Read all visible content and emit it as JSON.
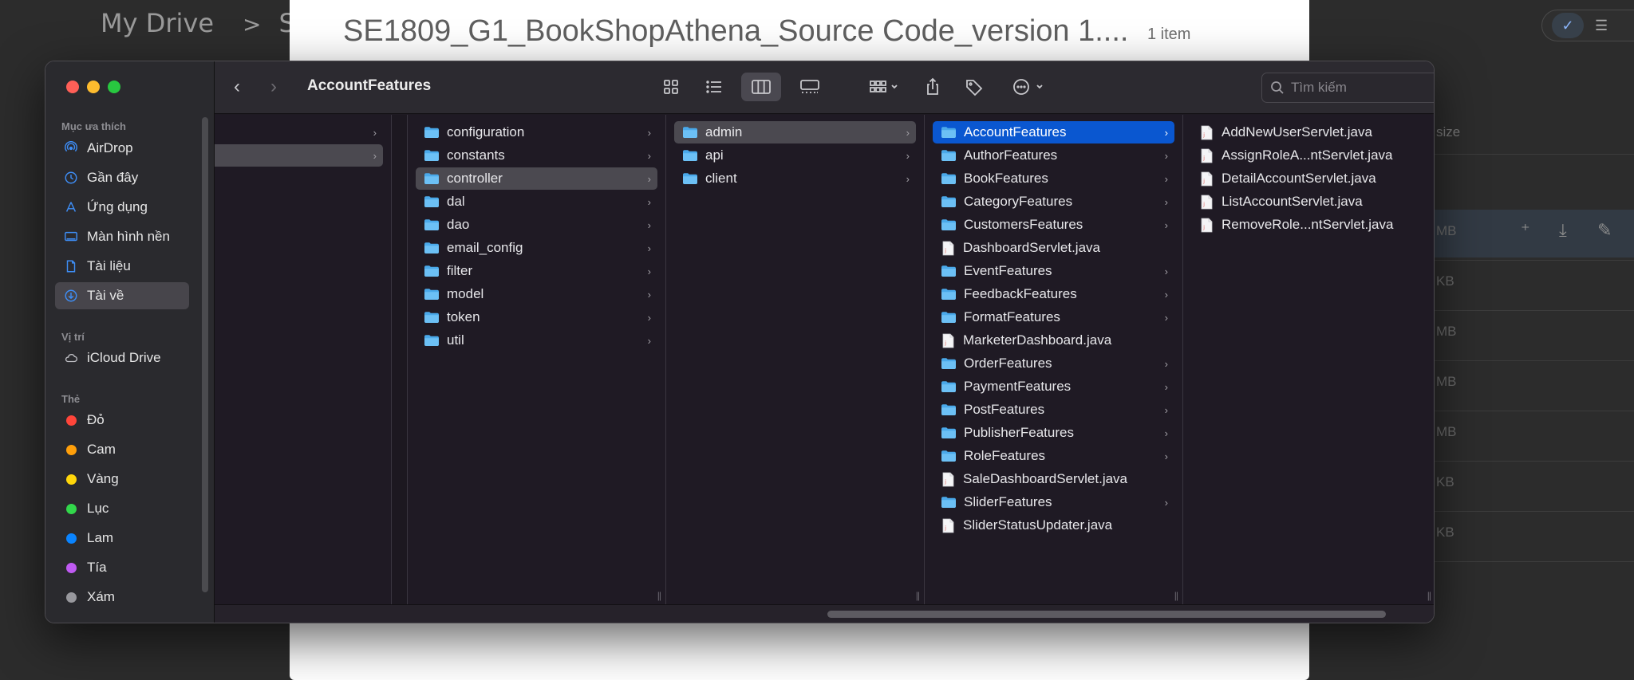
{
  "background": {
    "breadcrumb_root": "My Drive",
    "breadcrumb_sep": ">",
    "breadcrumb_current": "SE",
    "size_header": "size",
    "size_cells": [
      "MB",
      "KB",
      "MB",
      "MB",
      "MB",
      "KB",
      "KB"
    ]
  },
  "preview": {
    "title": "SE1809_G1_BookShopAthena_Source Code_version 1....",
    "count": "1 item"
  },
  "finder": {
    "toolbar": {
      "back": "‹",
      "forward": "›",
      "title": "AccountFeatures",
      "search_placeholder": "Tìm kiếm"
    },
    "sidebar": {
      "favorites_header": "Mục ưa thích",
      "favorites": [
        {
          "label": "AirDrop",
          "icon": "airdrop-icon"
        },
        {
          "label": "Gần đây",
          "icon": "clock-icon"
        },
        {
          "label": "Ứng dụng",
          "icon": "applications-icon"
        },
        {
          "label": "Màn hình nền",
          "icon": "desktop-icon"
        },
        {
          "label": "Tài liệu",
          "icon": "document-icon"
        },
        {
          "label": "Tài về",
          "icon": "download-icon"
        }
      ],
      "locations_header": "Vị trí",
      "locations": [
        {
          "label": "iCloud Drive",
          "icon": "cloud-icon"
        }
      ],
      "tags_header": "Thẻ",
      "tags": [
        {
          "label": "Đỏ",
          "color": "#ff453a"
        },
        {
          "label": "Cam",
          "color": "#ff9f0a"
        },
        {
          "label": "Vàng",
          "color": "#ffd60a"
        },
        {
          "label": "Lục",
          "color": "#32d74b"
        },
        {
          "label": "Lam",
          "color": "#0a84ff"
        },
        {
          "label": "Tía",
          "color": "#bf5af2"
        },
        {
          "label": "Xám",
          "color": "#98989d"
        }
      ]
    },
    "columns": {
      "col2": [
        "configuration",
        "constants",
        "controller",
        "dal",
        "dao",
        "email_config",
        "filter",
        "model",
        "token",
        "util"
      ],
      "col3": [
        "admin",
        "api",
        "client"
      ],
      "col4": [
        {
          "name": "AccountFeatures",
          "type": "folder"
        },
        {
          "name": "AuthorFeatures",
          "type": "folder"
        },
        {
          "name": "BookFeatures",
          "type": "folder"
        },
        {
          "name": "CategoryFeatures",
          "type": "folder"
        },
        {
          "name": "CustomersFeatures",
          "type": "folder"
        },
        {
          "name": "DashboardServlet.java",
          "type": "file"
        },
        {
          "name": "EventFeatures",
          "type": "folder"
        },
        {
          "name": "FeedbackFeatures",
          "type": "folder"
        },
        {
          "name": "FormatFeatures",
          "type": "folder"
        },
        {
          "name": "MarketerDashboard.java",
          "type": "file"
        },
        {
          "name": "OrderFeatures",
          "type": "folder"
        },
        {
          "name": "PaymentFeatures",
          "type": "folder"
        },
        {
          "name": "PostFeatures",
          "type": "folder"
        },
        {
          "name": "PublisherFeatures",
          "type": "folder"
        },
        {
          "name": "RoleFeatures",
          "type": "folder"
        },
        {
          "name": "SaleDashboardServlet.java",
          "type": "file"
        },
        {
          "name": "SliderFeatures",
          "type": "folder"
        },
        {
          "name": "SliderStatusUpdater.java",
          "type": "file"
        }
      ],
      "col5": [
        "AddNewUserServlet.java",
        "AssignRoleA...ntServlet.java",
        "DetailAccountServlet.java",
        "ListAccountServlet.java",
        "RemoveRole...ntServlet.java"
      ]
    },
    "selection": {
      "col2": "controller",
      "col3": "admin",
      "col4": "AccountFeatures"
    }
  }
}
